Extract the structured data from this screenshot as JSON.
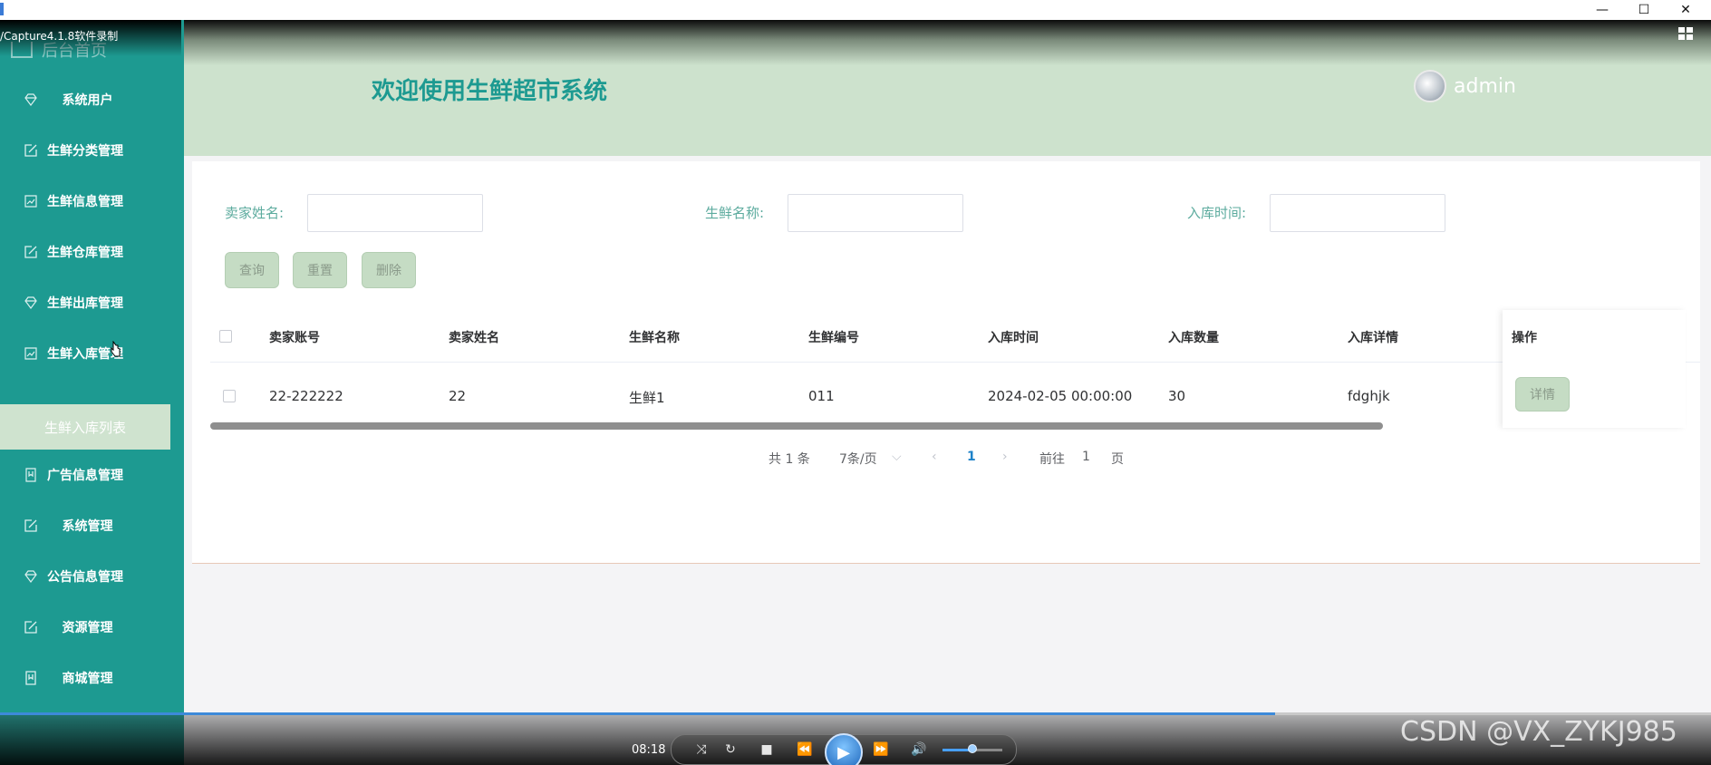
{
  "window": {
    "minimize_glyph": "—",
    "maximize_glyph": "☐",
    "close_glyph": "✕",
    "recorder_label": "/Capture4.1.8软件录制"
  },
  "sidebar": {
    "home_label": "后台首页",
    "items": [
      {
        "label": "系统用户",
        "icon": "diamond-icon"
      },
      {
        "label": "生鲜分类管理",
        "icon": "edit-icon"
      },
      {
        "label": "生鲜信息管理",
        "icon": "chart-icon"
      },
      {
        "label": "生鲜仓库管理",
        "icon": "edit-icon"
      },
      {
        "label": "生鲜出库管理",
        "icon": "diamond-icon"
      },
      {
        "label": "生鲜入库管理",
        "icon": "chart-icon"
      },
      {
        "label": "广告信息管理",
        "icon": "bookmark-icon"
      },
      {
        "label": "系统管理",
        "icon": "edit-icon"
      },
      {
        "label": "公告信息管理",
        "icon": "diamond-icon"
      },
      {
        "label": "资源管理",
        "icon": "edit-icon"
      },
      {
        "label": "商城管理",
        "icon": "bookmark-icon"
      }
    ],
    "active_submenu": "生鲜入库列表"
  },
  "header": {
    "title": "欢迎使用生鲜超市系统",
    "username": "admin"
  },
  "filters": {
    "seller_name_label": "卖家姓名:",
    "seller_name_value": "",
    "product_name_label": "生鲜名称:",
    "product_name_value": "",
    "stock_in_time_label": "入库时间:",
    "stock_in_time_value": ""
  },
  "actions": {
    "query": "查询",
    "reset": "重置",
    "delete": "删除"
  },
  "table": {
    "columns": [
      "卖家账号",
      "卖家姓名",
      "生鲜名称",
      "生鲜编号",
      "入库时间",
      "入库数量",
      "入库详情",
      "操作"
    ],
    "rows": [
      {
        "seller_account": "22-222222",
        "seller_name": "22",
        "product_name": "生鲜1",
        "product_code": "011",
        "stock_in_time": "2024-02-05 00:00:00",
        "quantity": "30",
        "details": "fdghjk",
        "action": "详情"
      }
    ]
  },
  "pagination": {
    "total_text": "共 1 条",
    "page_size_text": "7条/页",
    "current_page": "1",
    "goto_prefix": "前往",
    "goto_value": "1",
    "goto_suffix": "页"
  },
  "player": {
    "time": "08:18",
    "progress_fraction": 0.745,
    "volume_fraction": 0.5,
    "watermark": "CSDN @VX_ZYKJ985"
  }
}
